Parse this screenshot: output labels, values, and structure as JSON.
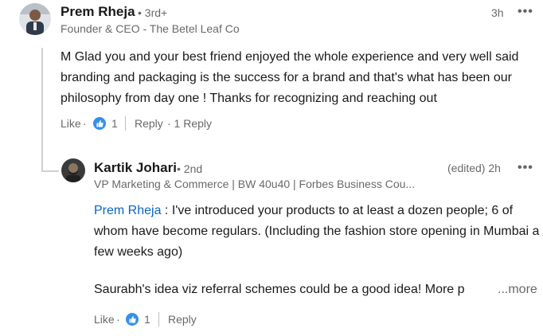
{
  "comment1": {
    "author": "Prem Rheja",
    "degree": "• 3rd+",
    "headline": "Founder & CEO - The Betel Leaf Co",
    "time": "3h",
    "more": "•••",
    "text": "M Glad you and your best friend enjoyed the whole experience and very well said branding and packaging is the success for a brand and that's what has been our philosophy from day one ! Thanks for recognizing and reaching out",
    "like_label": "Like",
    "dot": "·",
    "reactions_count": "1",
    "reply_label": "Reply",
    "reply_count": "· 1 Reply"
  },
  "comment2": {
    "author": "Kartik Johari",
    "degree": "• 2nd",
    "headline": "VP Marketing & Commerce | BW 40u40 | Forbes Business Cou...",
    "time": "(edited) 2h",
    "more": "•••",
    "mention": "Prem Rheja",
    "text_after_mention": " : I've introduced your products to at least a dozen people; 6 of whom have become regulars. (Including the fashion store opening in Mumbai a few weeks ago)",
    "text_para2": "Saurabh's idea viz referral schemes could be a good idea! More p",
    "see_more": "...more",
    "like_label": "Like",
    "dot": "·",
    "reactions_count": "1",
    "reply_label": "Reply"
  },
  "colors": {
    "link": "#0a66c2",
    "reaction": "#378fe9",
    "secondary_text": "rgba(0,0,0,0.6)"
  }
}
